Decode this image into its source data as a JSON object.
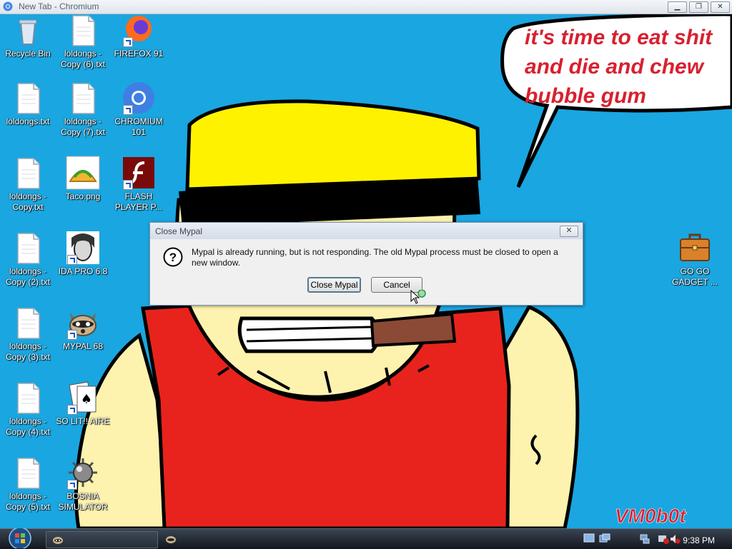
{
  "window": {
    "title": "New Tab - Chromium",
    "minimize_label": "▁",
    "restore_label": "❐",
    "close_label": "✕"
  },
  "wallpaper": {
    "speech_line1": "it's time to eat shit",
    "speech_line2": "and die and chew",
    "speech_line3": "bubble gum",
    "signature": "VM0b0t",
    "colors": {
      "sky": "#1aa6e0",
      "hat": "#fff200",
      "skin": "#fdf3ae",
      "shirt": "#e8231d",
      "text": "#d8202f"
    }
  },
  "desktop_icons": [
    {
      "label": "Recycle Bin",
      "icon": "recycle-bin-icon"
    },
    {
      "label": "loldongs -\nCopy (6).txt",
      "icon": "text-file-icon"
    },
    {
      "label": "FIREFOX 91",
      "icon": "firefox-icon"
    },
    {
      "label": "loldongs.txt",
      "icon": "text-file-icon"
    },
    {
      "label": "loldongs -\nCopy (7).txt",
      "icon": "text-file-icon"
    },
    {
      "label": "CHROMIUM\n101",
      "icon": "chromium-icon"
    },
    {
      "label": "loldongs -\nCopy.txt",
      "icon": "text-file-icon"
    },
    {
      "label": "Taco.png",
      "icon": "taco-image-icon"
    },
    {
      "label": "FLASH\nPLAYER P...",
      "icon": "flash-player-icon"
    },
    {
      "label": "loldongs -\nCopy (2).txt",
      "icon": "text-file-icon"
    },
    {
      "label": "IDA PRO 6.8",
      "icon": "ida-pro-icon"
    },
    {
      "label": "loldongs -\nCopy (3).txt",
      "icon": "text-file-icon"
    },
    {
      "label": "MYPAL 68",
      "icon": "mypal-raccoon-icon"
    },
    {
      "label": "loldongs -\nCopy (4).txt",
      "icon": "text-file-icon"
    },
    {
      "label": "SO LIT!! AIRE",
      "icon": "solitaire-cards-icon"
    },
    {
      "label": "loldongs -\nCopy (5).txt",
      "icon": "text-file-icon"
    },
    {
      "label": "BOSNIA\nSIMULATOR",
      "icon": "minesweeper-mine-icon"
    },
    {
      "label": "GO GO\nGADGET ...",
      "icon": "briefcase-icon"
    }
  ],
  "dialog": {
    "title": "Close Mypal",
    "close_label": "✕",
    "message": "Mypal is already running, but is not responding. The old Mypal process must be closed to open a new window.",
    "primary_button": "Close Mypal",
    "secondary_button": "Cancel"
  },
  "taskbar": {
    "clock": "9:38 PM"
  }
}
